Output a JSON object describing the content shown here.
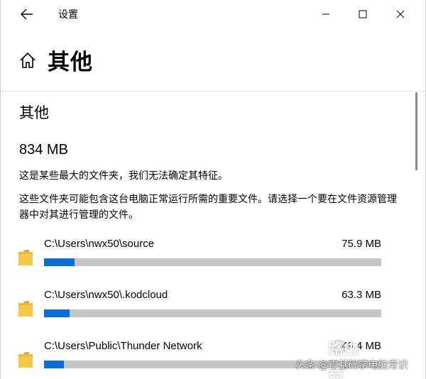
{
  "window": {
    "title": "设置"
  },
  "page": {
    "title": "其他"
  },
  "section": {
    "title": "其他",
    "total_size": "834 MB",
    "description_1": "这是某些最大的文件夹，我们无法确定其特征。",
    "description_2": "这些文件夹可能包含这台电脑正常运行所需的重要文件。请选择一个要在文件资源管理器中对其进行管理的文件。"
  },
  "folders": [
    {
      "path": "C:\\Users\\nwx50\\source",
      "size": "75.9 MB",
      "usage_fraction": 0.09
    },
    {
      "path": "C:\\Users\\nwx50\\.kodcloud",
      "size": "63.3 MB",
      "usage_fraction": 0.076
    },
    {
      "path": "C:\\Users\\Public\\Thunder Network",
      "size": "49.4 MB",
      "usage_fraction": 0.059
    }
  ],
  "watermark": {
    "logo_text": "路由器",
    "caption": "头条 @零基础学电脑常识"
  },
  "icons": {
    "back": "back-arrow-icon",
    "minimize": "minimize-icon",
    "maximize": "maximize-icon",
    "close": "close-icon",
    "home": "home-icon",
    "folder": "folder-icon"
  },
  "colors": {
    "accent": "#0b6ed6",
    "bar_track": "#c6c6c6",
    "folder": "#f2c94c"
  }
}
